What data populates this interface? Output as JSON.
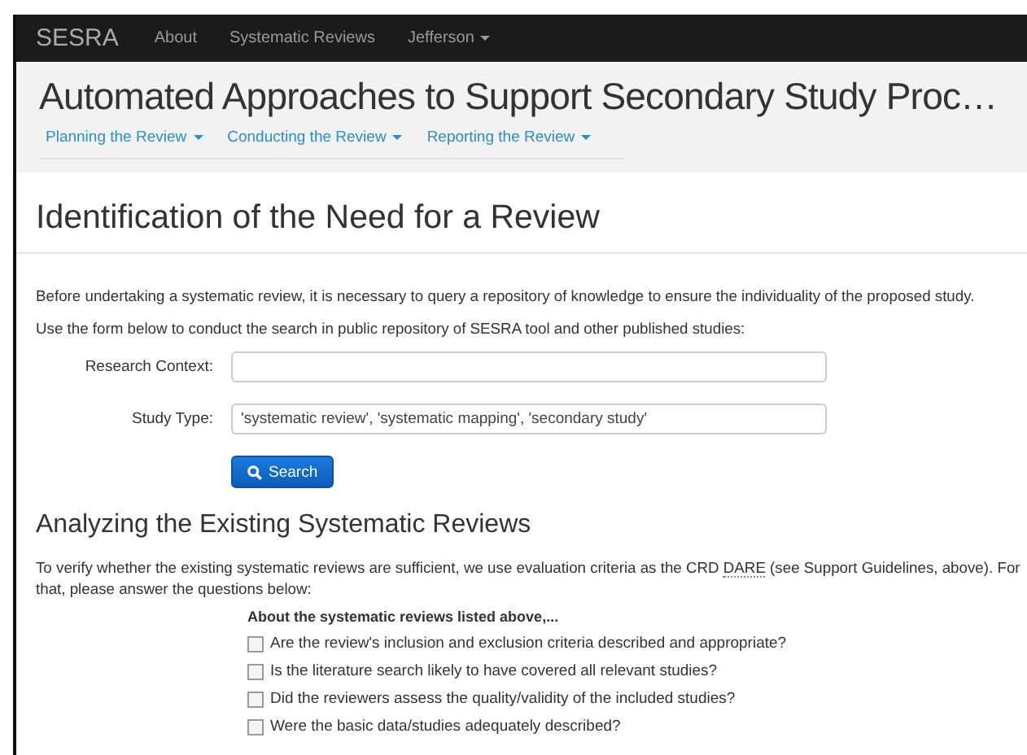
{
  "navbar": {
    "brand": "SESRA",
    "items": [
      {
        "label": "About",
        "dropdown": false
      },
      {
        "label": "Systematic Reviews",
        "dropdown": false
      },
      {
        "label": "Jefferson",
        "dropdown": true
      }
    ]
  },
  "header": {
    "title": "Automated Approaches to Support Secondary Study Proc…",
    "tabs": [
      {
        "label": "Planning the Review"
      },
      {
        "label": "Conducting the Review"
      },
      {
        "label": "Reporting the Review"
      }
    ]
  },
  "section_1": {
    "heading": "Identification of the Need for a Review",
    "paragraphs": [
      "Before undertaking a systematic review, it is necessary to query a repository of knowledge to ensure the individuality of the proposed study.",
      "Use the form below to conduct the search in public repository of SESRA tool and other published studies:"
    ],
    "fields": [
      {
        "label": "Research Context:"
      },
      {
        "label": "Study Type:",
        "value": "'systematic review', 'systematic mapping', 'secondary study'"
      }
    ],
    "search_button": "Search"
  },
  "section_2": {
    "heading": "Analyzing the Existing Systematic Reviews",
    "intro_before": "To verify whether the existing systematic reviews are sufficient, we use evaluation criteria as the CRD ",
    "intro_abbr": "DARE",
    "intro_after": " (see Support Guidelines, above). For that, please answer the questions below:",
    "question_title": "About the systematic reviews listed above,...",
    "questions": [
      {
        "label": "Are the review's inclusion and exclusion criteria described and appropriate?",
        "checked": false
      },
      {
        "label": "Is the literature search likely to have covered all relevant studies?",
        "checked": false
      },
      {
        "label": "Did the reviewers assess the quality/validity of the included studies?",
        "checked": false
      },
      {
        "label": "Were the basic data/studies adequately described?",
        "checked": false
      }
    ]
  }
}
